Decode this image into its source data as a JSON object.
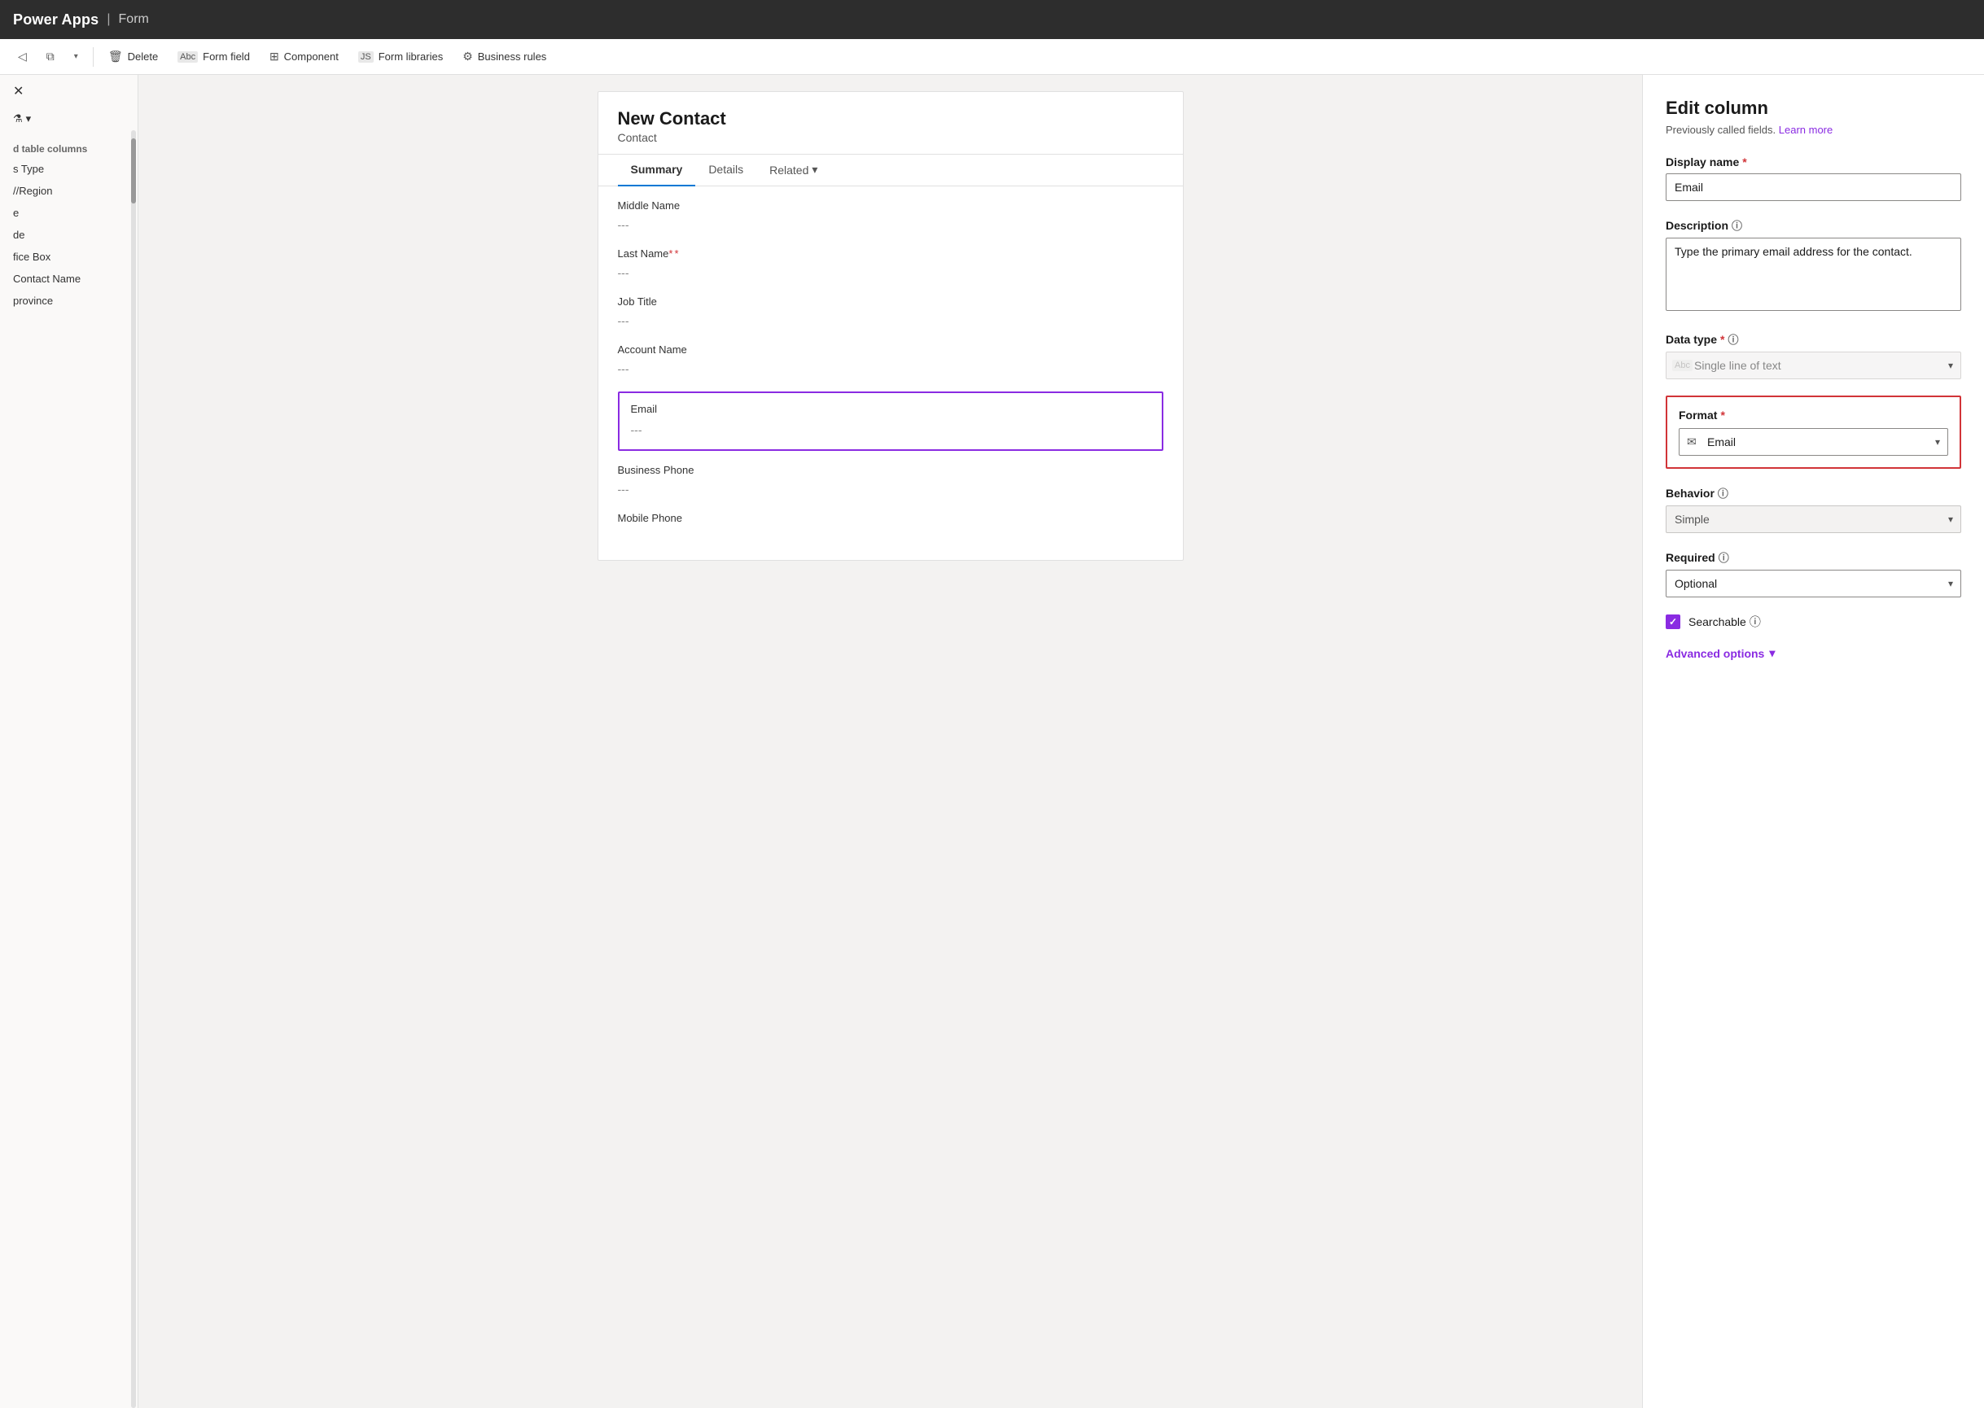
{
  "topbar": {
    "title": "Power Apps",
    "separator": "|",
    "subtitle": "Form"
  },
  "toolbar": {
    "back_icon": "◁",
    "copy_icon": "⧉",
    "chevron": "▾",
    "delete_label": "Delete",
    "delete_icon": "🗑",
    "form_field_label": "Form field",
    "form_field_icon": "Abc",
    "component_label": "Component",
    "component_icon": "⊞",
    "form_libraries_label": "Form libraries",
    "form_libraries_icon": "JS",
    "business_rules_label": "Business rules",
    "business_rules_icon": "⚙"
  },
  "sidebar": {
    "close_label": "✕",
    "filter_icon": "⚗",
    "filter_chevron": "▾",
    "section_header": "d table columns",
    "items": [
      {
        "label": "s Type"
      },
      {
        "label": "//Region"
      },
      {
        "label": "e"
      },
      {
        "label": "de"
      },
      {
        "label": "fice Box"
      },
      {
        "label": "Contact Name"
      },
      {
        "label": "province"
      }
    ]
  },
  "form": {
    "title": "New Contact",
    "subtitle": "Contact",
    "tabs": [
      {
        "label": "Summary",
        "active": true
      },
      {
        "label": "Details",
        "active": false
      },
      {
        "label": "Related",
        "active": false
      }
    ],
    "related_chevron": "▾",
    "fields": [
      {
        "label": "Middle Name",
        "value": "---",
        "required": false,
        "selected": false
      },
      {
        "label": "Last Name",
        "value": "---",
        "required": true,
        "selected": false
      },
      {
        "label": "Job Title",
        "value": "---",
        "required": false,
        "selected": false
      },
      {
        "label": "Account Name",
        "value": "---",
        "required": false,
        "selected": false
      },
      {
        "label": "Email",
        "value": "---",
        "required": false,
        "selected": true
      },
      {
        "label": "Business Phone",
        "value": "---",
        "required": false,
        "selected": false
      },
      {
        "label": "Mobile Phone",
        "value": "",
        "required": false,
        "selected": false
      }
    ]
  },
  "edit_panel": {
    "title": "Edit column",
    "subtitle": "Previously called fields.",
    "learn_more": "Learn more",
    "display_name_label": "Display name",
    "display_name_required": true,
    "display_name_value": "Email",
    "description_label": "Description",
    "description_info": true,
    "description_value": "Type the primary email address for the contact.",
    "data_type_label": "Data type",
    "data_type_required": true,
    "data_type_info": true,
    "data_type_icon": "Abc",
    "data_type_value": "Single line of text",
    "format_label": "Format",
    "format_required": true,
    "format_icon": "✉",
    "format_value": "Email",
    "behavior_label": "Behavior",
    "behavior_info": true,
    "behavior_value": "Simple",
    "required_label": "Required",
    "required_info": true,
    "required_value": "Optional",
    "searchable_label": "Searchable",
    "searchable_info": true,
    "searchable_checked": true,
    "advanced_options_label": "Advanced options",
    "advanced_chevron": "▾"
  }
}
